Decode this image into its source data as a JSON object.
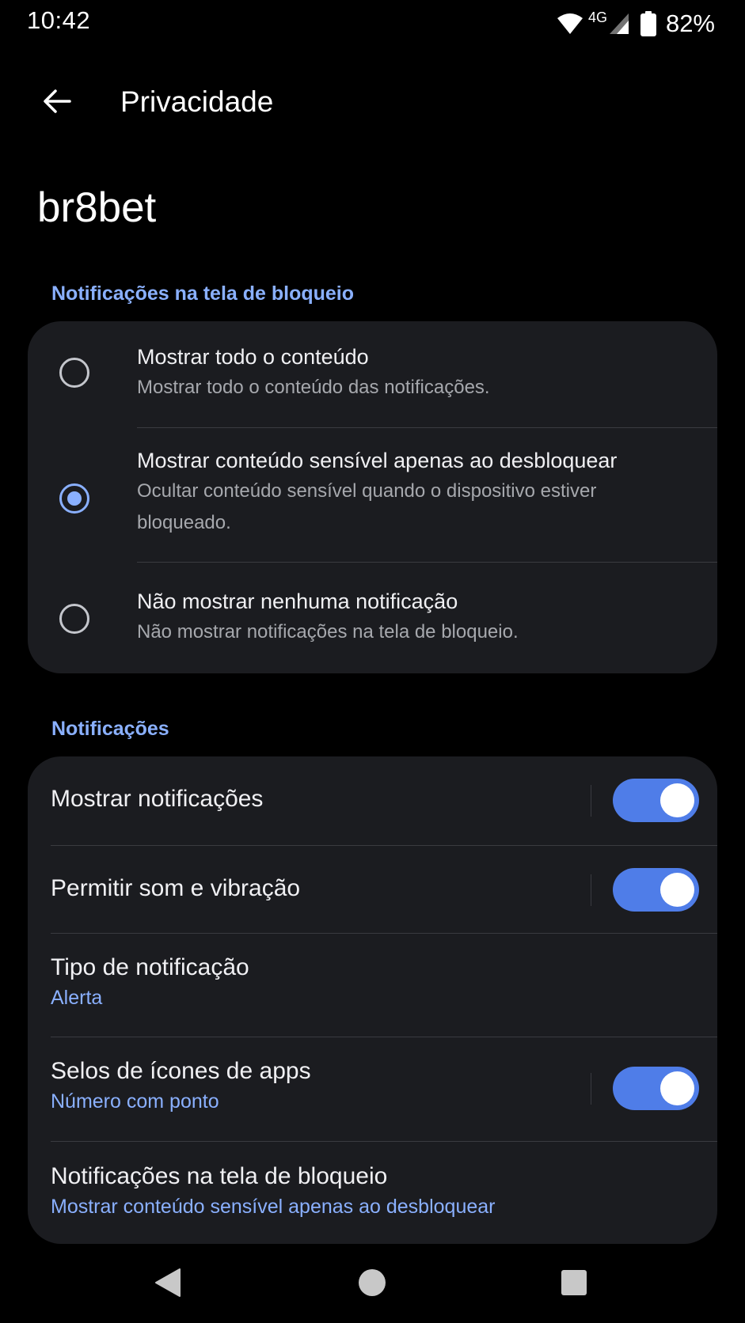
{
  "status_bar": {
    "time": "10:42",
    "network": "4G",
    "battery": "82%",
    "icons": [
      "wifi-icon",
      "signal-icon",
      "battery-icon"
    ]
  },
  "app_bar": {
    "back_icon": "arrow-back-icon",
    "title": "Privacidade"
  },
  "app_name": "br8bet",
  "lockscreen_section": {
    "header": "Notificações na tela de bloqueio",
    "options": [
      {
        "title": "Mostrar todo o conteúdo",
        "subtitle": "Mostrar todo o conteúdo das notificações.",
        "selected": false
      },
      {
        "title": "Mostrar conteúdo sensível apenas ao desbloquear",
        "subtitle": "Ocultar conteúdo sensível quando o dispositivo estiver bloqueado.",
        "selected": true
      },
      {
        "title": "Não mostrar nenhuma notificação",
        "subtitle": "Não mostrar notificações na tela de bloqueio.",
        "selected": false
      }
    ]
  },
  "notifications_section": {
    "header": "Notificações",
    "items": [
      {
        "title": "Mostrar notificações",
        "subtitle": "",
        "toggle": true,
        "on": true
      },
      {
        "title": "Permitir som e vibração",
        "subtitle": "",
        "toggle": true,
        "on": true
      },
      {
        "title": "Tipo de notificação",
        "subtitle": "Alerta",
        "toggle": false
      },
      {
        "title": "Selos de ícones de apps",
        "subtitle": "Número com ponto",
        "toggle": true,
        "on": true
      },
      {
        "title": "Notificações na tela de bloqueio",
        "subtitle": "Mostrar conteúdo sensível apenas ao desbloquear",
        "toggle": false
      }
    ]
  },
  "nav_bar": {
    "icons": [
      "back-triangle-icon",
      "home-circle-icon",
      "recents-square-icon"
    ]
  },
  "colors": {
    "background": "#000000",
    "card": "#1b1c20",
    "accent": "#8ab0ff",
    "toggle_on": "#4f7de8"
  }
}
